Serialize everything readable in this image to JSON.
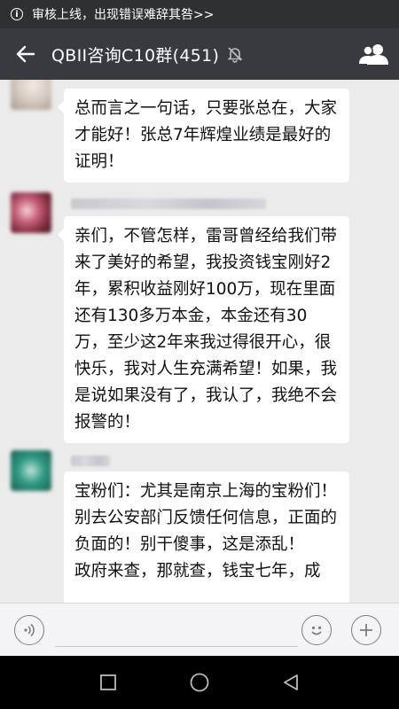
{
  "notice": {
    "icon": "info-icon",
    "text": "审核上线，出现错误难辞其咎>>"
  },
  "header": {
    "back_icon": "back-arrow-icon",
    "title": "QBII咨询C10群(451)",
    "mute_icon": "muted-bell-icon",
    "members_icon": "group-members-icon"
  },
  "messages": [
    {
      "text": "总而言之一句话，只要张总在，大家才能好！张总7年辉煌业绩是最好的证明！"
    },
    {
      "text": "亲们，不管怎样，雷哥曾经给我们带来了美好的希望，我投资钱宝刚好2年，累积收益刚好100万，现在里面还有130多万本金，本金还有30万，至少这2年来我过得很开心，很快乐，我对人生充满希望！如果，我是说如果没有了，我认了，我绝不会报警的！"
    },
    {
      "text": "宝粉们：尤其是南京上海的宝粉们！别去公安部门反馈任何信息，正面的负面的！别干傻事，这是添乱！\n政府来查，那就查，钱宝七年，成"
    }
  ],
  "input_bar": {
    "voice_icon": "voice-icon",
    "text_value": "",
    "emoji_icon": "emoji-icon",
    "plus_icon": "plus-icon"
  },
  "nav": {
    "recent_icon": "recent-apps-icon",
    "home_icon": "home-icon",
    "back_icon": "nav-back-icon"
  },
  "colors": {
    "notice_bg": "#2f3033",
    "titlebar_bg": "#393a3f",
    "chat_bg": "#ebebeb",
    "bubble_bg": "#ffffff",
    "navbar_bg": "#000000"
  }
}
